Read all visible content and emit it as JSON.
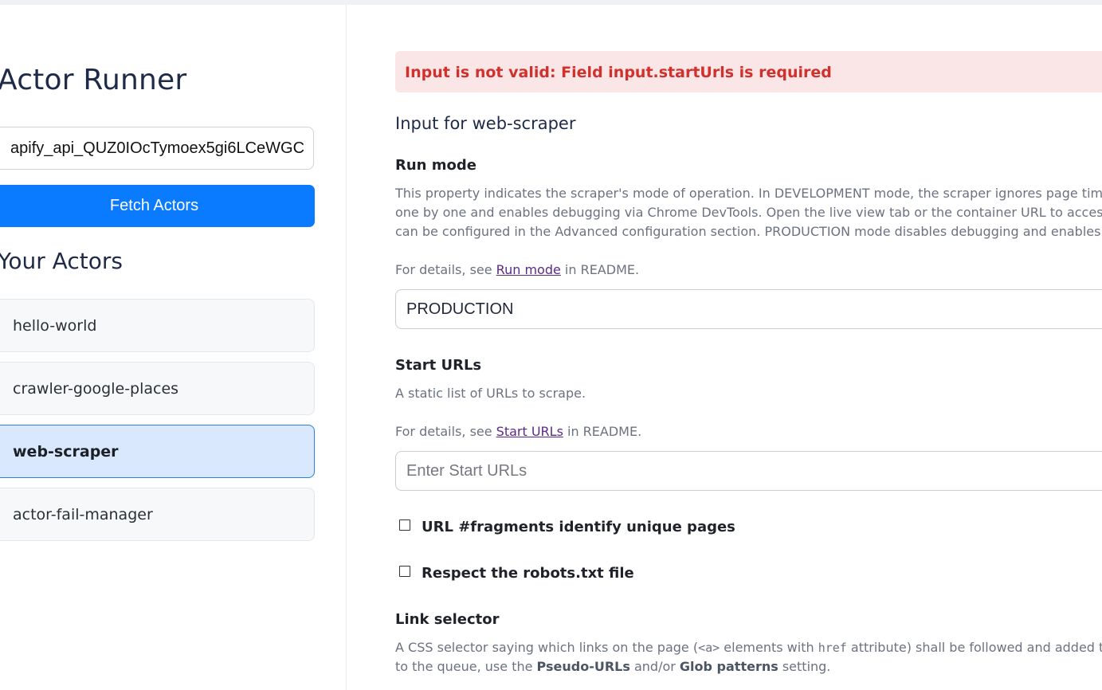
{
  "sidebar": {
    "title": "Actor Runner",
    "api_key_value": "apify_api_QUZ0IOcTymoex5gi6LCeWGC",
    "fetch_button": "Fetch Actors",
    "actors_heading": "Your Actors",
    "actors": [
      {
        "label": "hello-world",
        "selected": false
      },
      {
        "label": "crawler-google-places",
        "selected": false
      },
      {
        "label": "web-scraper",
        "selected": true
      },
      {
        "label": "actor-fail-manager",
        "selected": false
      }
    ]
  },
  "main": {
    "error": "Input is not valid: Field input.startUrls is required",
    "heading": "Input for web-scraper",
    "run_mode": {
      "label": "Run mode",
      "desc_lines": [
        "This property indicates the scraper's mode of operation. In DEVELOPMENT mode, the scraper ignores page timeo",
        "one by one and enables debugging via Chrome DevTools. Open the live view tab or the container URL to access",
        "can be configured in the Advanced configuration section. PRODUCTION mode disables debugging and enables"
      ],
      "details_prefix": "For details, see ",
      "details_link": "Run mode",
      "details_suffix": " in README.",
      "value": "PRODUCTION"
    },
    "start_urls": {
      "label": "Start URLs",
      "desc": "A static list of URLs to scrape.",
      "details_prefix": "For details, see ",
      "details_link": "Start URLs",
      "details_suffix": " in README.",
      "placeholder": "Enter Start URLs"
    },
    "checkboxes": [
      {
        "label": "URL #fragments identify unique pages",
        "checked": false
      },
      {
        "label": "Respect the robots.txt file",
        "checked": false
      }
    ],
    "link_selector": {
      "label": "Link selector",
      "line1_a": "A CSS selector saying which links on the page (",
      "line1_code1": "<a>",
      "line1_b": " elements with ",
      "line1_code2": "href",
      "line1_c": " attribute) shall be followed and added to",
      "line2_a": "to the queue, use the ",
      "line2_bold1": "Pseudo-URLs",
      "line2_b": " and/or ",
      "line2_bold2": "Glob patterns",
      "line2_c": " setting."
    }
  }
}
